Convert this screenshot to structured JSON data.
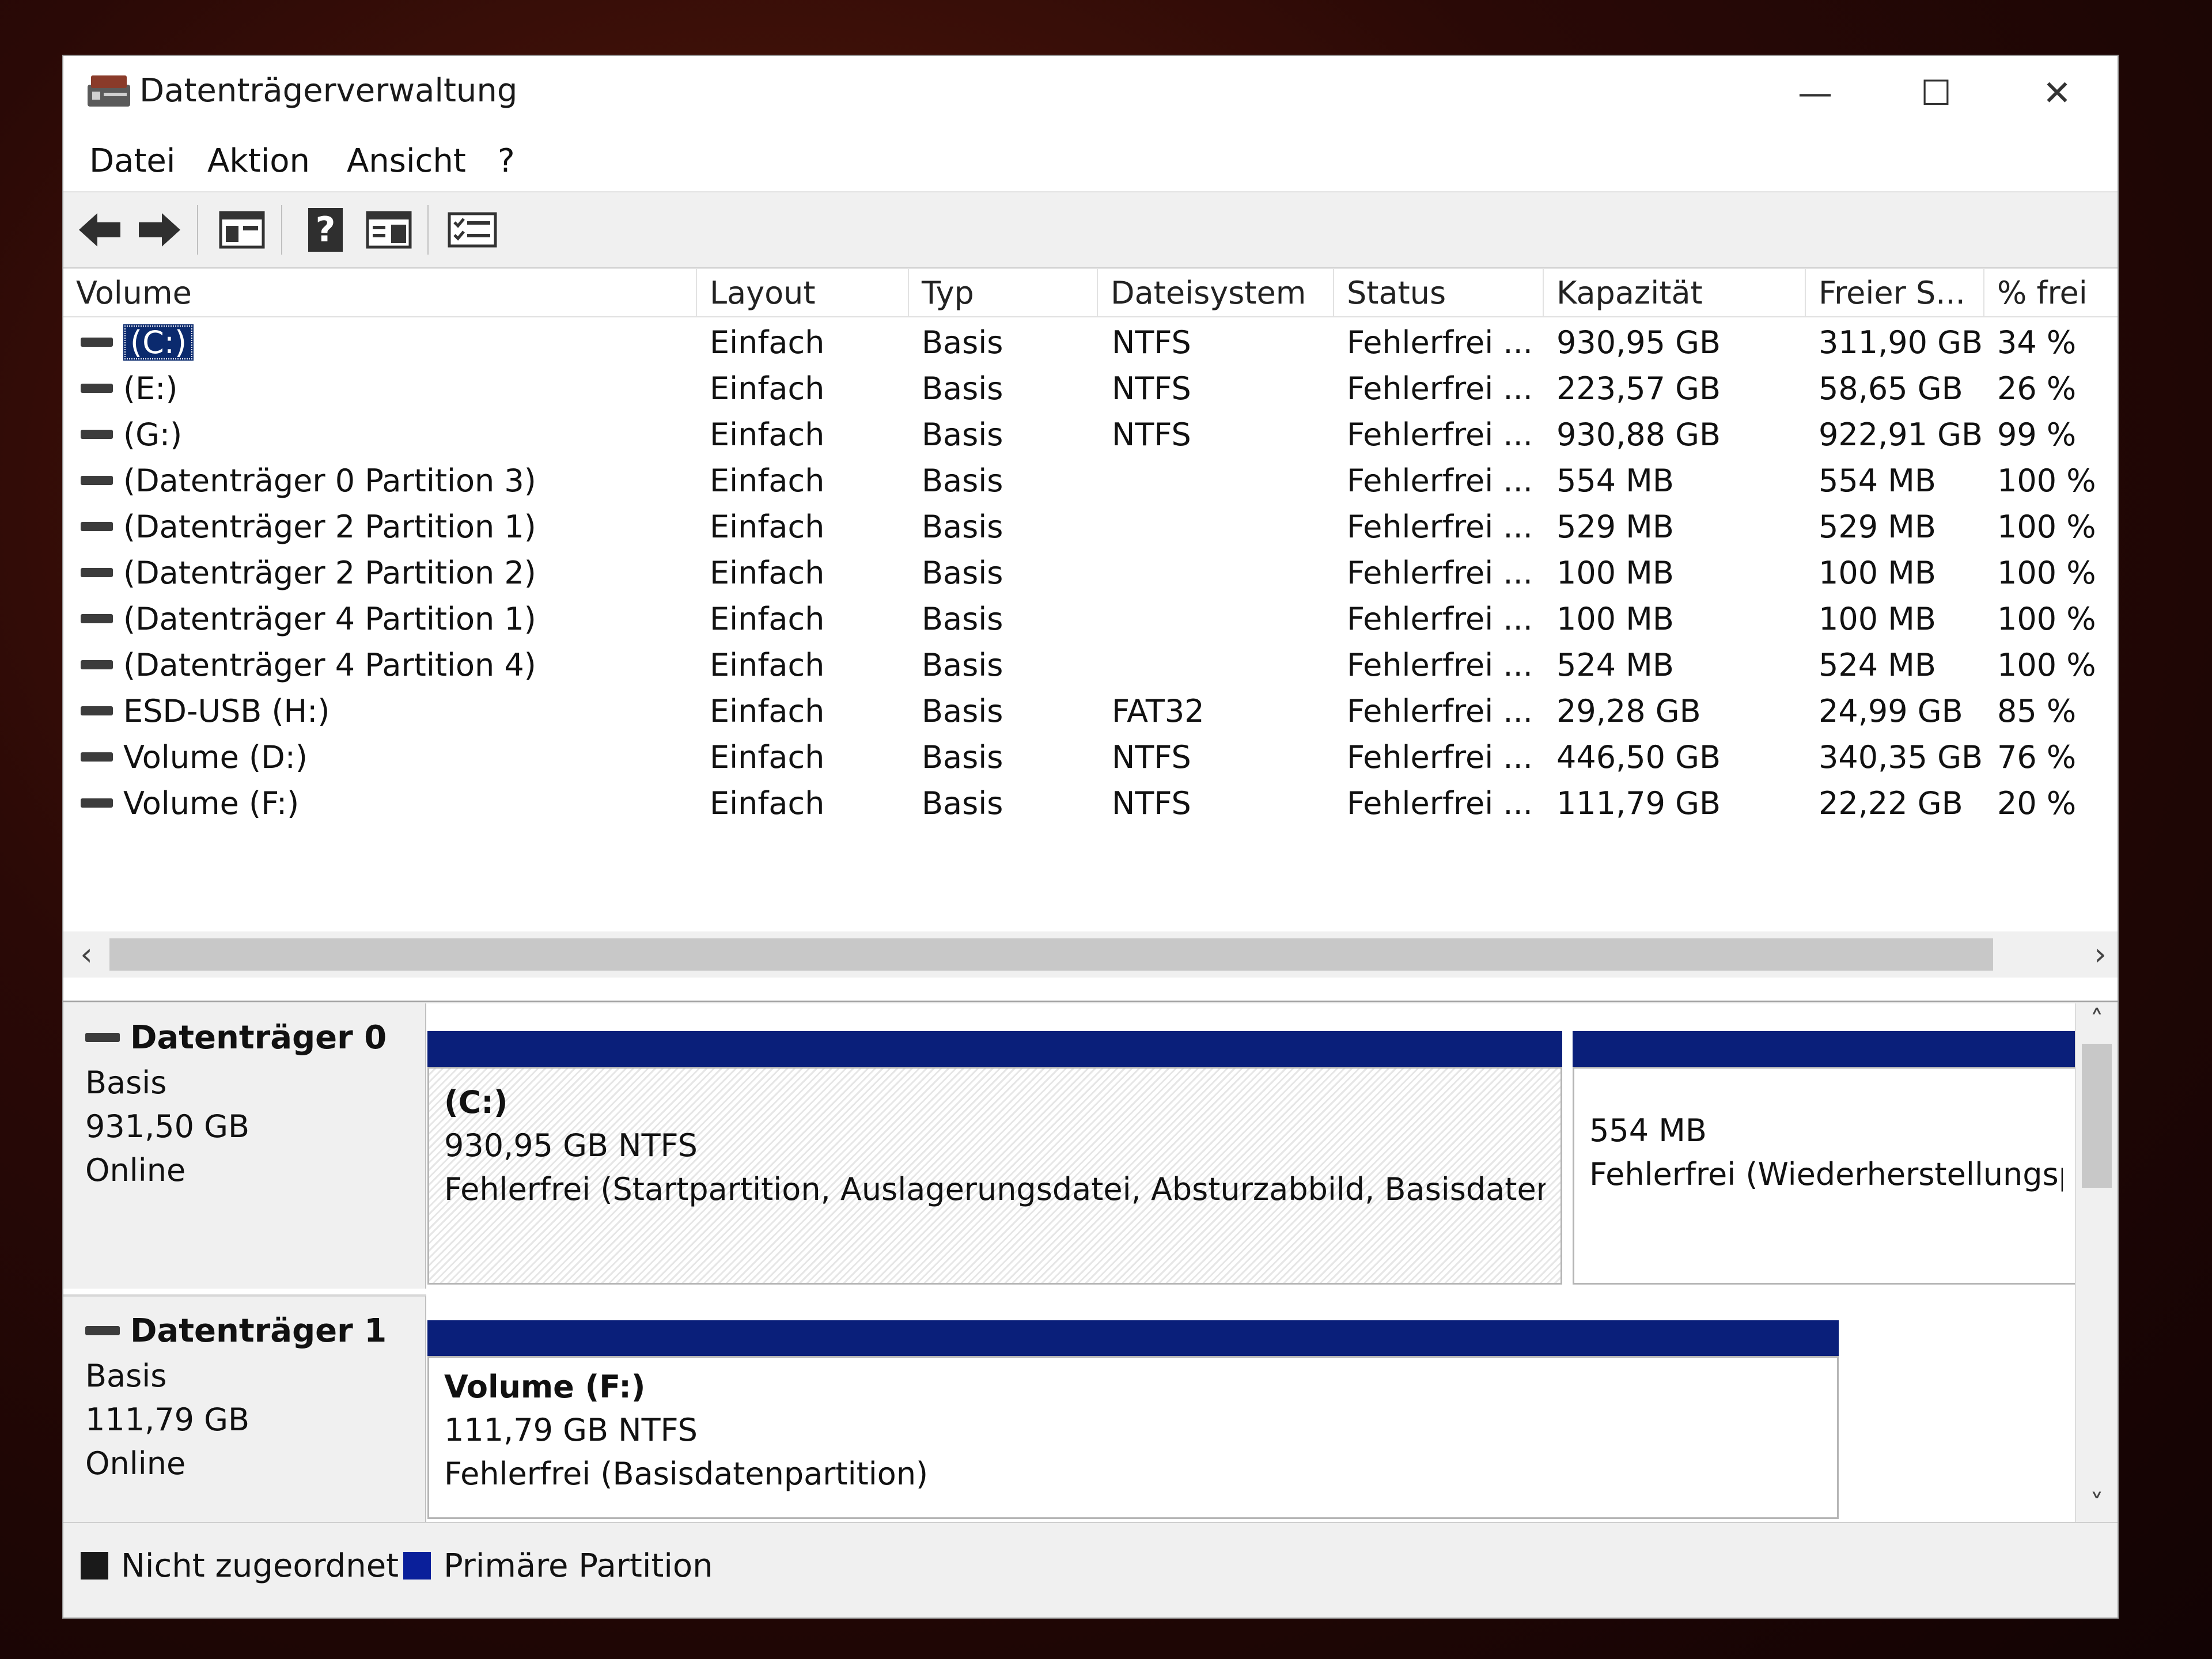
{
  "window": {
    "title": "Datenträgerverwaltung",
    "controls": {
      "minimize": "—",
      "maximize": "☐",
      "close": "✕"
    }
  },
  "menu": [
    "Datei",
    "Aktion",
    "Ansicht",
    "?"
  ],
  "toolbar": {
    "icons": [
      "back-arrow-icon",
      "forward-arrow-icon",
      "console-tree-icon",
      "help-icon",
      "panel-view-icon",
      "properties-icon"
    ],
    "help_glyph": "?"
  },
  "volume_table": {
    "columns": [
      "Volume",
      "Layout",
      "Typ",
      "Dateisystem",
      "Status",
      "Kapazität",
      "Freier S...",
      "% frei"
    ],
    "rows": [
      {
        "volume": "(C:)",
        "layout": "Einfach",
        "typ": "Basis",
        "fs": "NTFS",
        "status": "Fehlerfrei ...",
        "cap": "930,95 GB",
        "free": "311,90 GB",
        "pct": "34 %",
        "selected": true
      },
      {
        "volume": "(E:)",
        "layout": "Einfach",
        "typ": "Basis",
        "fs": "NTFS",
        "status": "Fehlerfrei ...",
        "cap": "223,57 GB",
        "free": "58,65 GB",
        "pct": "26 %"
      },
      {
        "volume": "(G:)",
        "layout": "Einfach",
        "typ": "Basis",
        "fs": "NTFS",
        "status": "Fehlerfrei ...",
        "cap": "930,88 GB",
        "free": "922,91 GB",
        "pct": "99 %"
      },
      {
        "volume": "(Datenträger 0 Partition 3)",
        "layout": "Einfach",
        "typ": "Basis",
        "fs": "",
        "status": "Fehlerfrei ...",
        "cap": "554 MB",
        "free": "554 MB",
        "pct": "100 %"
      },
      {
        "volume": "(Datenträger 2 Partition 1)",
        "layout": "Einfach",
        "typ": "Basis",
        "fs": "",
        "status": "Fehlerfrei ...",
        "cap": "529 MB",
        "free": "529 MB",
        "pct": "100 %"
      },
      {
        "volume": "(Datenträger 2 Partition 2)",
        "layout": "Einfach",
        "typ": "Basis",
        "fs": "",
        "status": "Fehlerfrei ...",
        "cap": "100 MB",
        "free": "100 MB",
        "pct": "100 %"
      },
      {
        "volume": "(Datenträger 4 Partition 1)",
        "layout": "Einfach",
        "typ": "Basis",
        "fs": "",
        "status": "Fehlerfrei ...",
        "cap": "100 MB",
        "free": "100 MB",
        "pct": "100 %"
      },
      {
        "volume": "(Datenträger 4 Partition 4)",
        "layout": "Einfach",
        "typ": "Basis",
        "fs": "",
        "status": "Fehlerfrei ...",
        "cap": "524 MB",
        "free": "524 MB",
        "pct": "100 %"
      },
      {
        "volume": "ESD-USB (H:)",
        "layout": "Einfach",
        "typ": "Basis",
        "fs": "FAT32",
        "status": "Fehlerfrei ...",
        "cap": "29,28 GB",
        "free": "24,99 GB",
        "pct": "85 %"
      },
      {
        "volume": "Volume (D:)",
        "layout": "Einfach",
        "typ": "Basis",
        "fs": "NTFS",
        "status": "Fehlerfrei ...",
        "cap": "446,50 GB",
        "free": "340,35 GB",
        "pct": "76 %"
      },
      {
        "volume": "Volume (F:)",
        "layout": "Einfach",
        "typ": "Basis",
        "fs": "NTFS",
        "status": "Fehlerfrei ...",
        "cap": "111,79 GB",
        "free": "22,22 GB",
        "pct": "20 %"
      }
    ],
    "hscroll": {
      "left": "‹",
      "right": "›"
    }
  },
  "disks": [
    {
      "name": "Datenträger 0",
      "type": "Basis",
      "size": "931,50 GB",
      "state": "Online",
      "partitions": [
        {
          "title": "(C:)",
          "line1": "930,95 GB NTFS",
          "line2": "Fehlerfrei (Startpartition, Auslagerungsdatei, Absturzabbild, Basisdatenpart",
          "hatched": true
        },
        {
          "title": "",
          "line1": "554 MB",
          "line2": "Fehlerfrei (Wiederherstellungspa",
          "hatched": false
        }
      ]
    },
    {
      "name": "Datenträger 1",
      "type": "Basis",
      "size": "111,79 GB",
      "state": "Online",
      "partitions": [
        {
          "title": "Volume  (F:)",
          "line1": "111,79 GB NTFS",
          "line2": "Fehlerfrei (Basisdatenpartition)",
          "hatched": false
        }
      ]
    }
  ],
  "vscroll": {
    "up": "˄",
    "down": "˅"
  },
  "legend": [
    {
      "label": "Nicht zugeordnet",
      "color": "#1a1a1a"
    },
    {
      "label": "Primäre Partition",
      "color": "#0a1f9a"
    }
  ],
  "colors": {
    "partition_bar": "#0a1f7a",
    "selection": "#0b2a6e"
  }
}
